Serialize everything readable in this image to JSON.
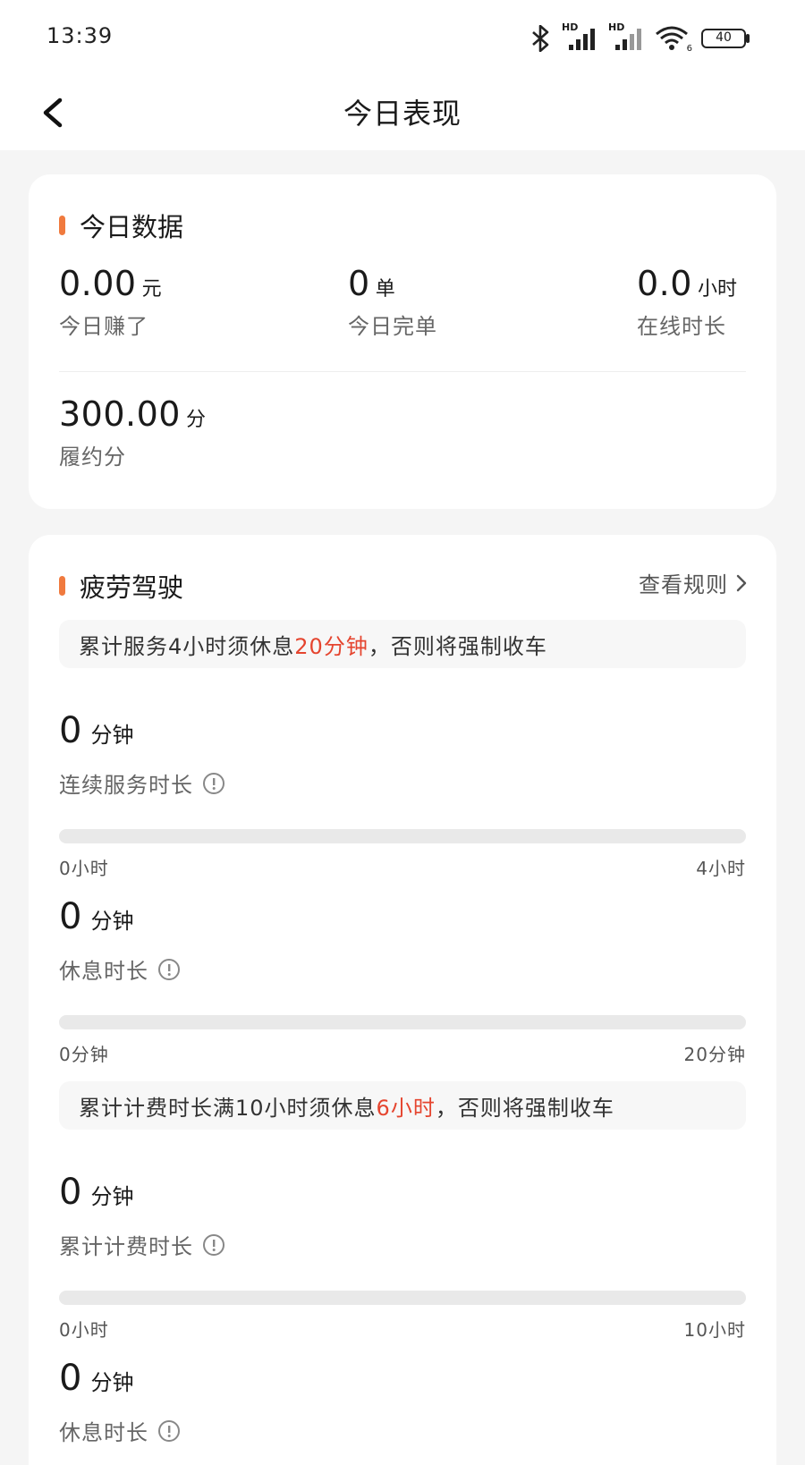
{
  "status": {
    "time": "13:39",
    "battery": "40",
    "wifi_badge": "6",
    "hd1": "HD",
    "hd2": "HD"
  },
  "nav": {
    "title": "今日表现"
  },
  "today": {
    "title": "今日数据",
    "earned": {
      "value": "0.00",
      "unit": "元",
      "label": "今日赚了"
    },
    "orders": {
      "value": "0",
      "unit": "单",
      "label": "今日完单"
    },
    "online": {
      "value": "0.0",
      "unit": "小时",
      "label": "在线时长"
    },
    "score": {
      "value": "300.00",
      "unit": "分",
      "label": "履约分"
    }
  },
  "fatigue": {
    "title": "疲劳驾驶",
    "rule_link": "查看规则",
    "notice1": {
      "pre": "累计服务4小时须休息",
      "highlight": "20分钟",
      "post": "，否则将强制收车"
    },
    "notice2": {
      "pre": "累计计费时长满10小时须休息",
      "highlight": "6小时",
      "post": "，否则将强制收车"
    },
    "metrics": [
      {
        "value": "0",
        "unit": "分钟",
        "label": "连续服务时长",
        "min": "0小时",
        "max": "4小时",
        "progress": 0
      },
      {
        "value": "0",
        "unit": "分钟",
        "label": "休息时长",
        "min": "0分钟",
        "max": "20分钟",
        "progress": 0
      },
      {
        "value": "0",
        "unit": "分钟",
        "label": "累计计费时长",
        "min": "0小时",
        "max": "10小时",
        "progress": 0
      },
      {
        "value": "0",
        "unit": "分钟",
        "label": "休息时长"
      }
    ]
  },
  "colors": {
    "accent": "#f07a3e",
    "highlight": "#e5452f"
  }
}
